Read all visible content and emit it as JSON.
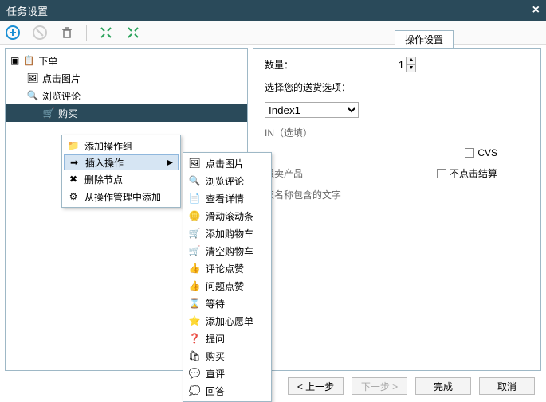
{
  "window": {
    "title": "任务设置",
    "close": "×"
  },
  "toolbar_icons": [
    "add",
    "stop",
    "trash",
    "expand",
    "collapse"
  ],
  "tree": {
    "root": "下单",
    "children": [
      {
        "label": "点击图片"
      },
      {
        "label": "浏览评论"
      },
      {
        "label": "购买",
        "selected": true
      }
    ]
  },
  "context_menu_1": {
    "items": [
      {
        "icon": "group",
        "label": "添加操作组"
      },
      {
        "icon": "insert",
        "label": "插入操作",
        "has_submenu": true,
        "highlighted": true
      },
      {
        "icon": "delete",
        "label": "删除节点"
      },
      {
        "icon": "fromlib",
        "label": "从操作管理中添加"
      }
    ]
  },
  "context_menu_2": {
    "items": [
      {
        "icon": "image",
        "label": "点击图片"
      },
      {
        "icon": "browse",
        "label": "浏览评论"
      },
      {
        "icon": "detail",
        "label": "查看详情"
      },
      {
        "icon": "scroll",
        "label": "滑动滚动条"
      },
      {
        "icon": "cart_add",
        "label": "添加购物车"
      },
      {
        "icon": "cart_clear",
        "label": "清空购物车"
      },
      {
        "icon": "thumb",
        "label": "评论点赞"
      },
      {
        "icon": "question",
        "label": "问题点赞"
      },
      {
        "icon": "wait",
        "label": "等待"
      },
      {
        "icon": "wish",
        "label": "添加心愿单"
      },
      {
        "icon": "ask",
        "label": "提问"
      },
      {
        "icon": "buy",
        "label": "购买"
      },
      {
        "icon": "live",
        "label": "直评"
      },
      {
        "icon": "answer",
        "label": "回答"
      }
    ]
  },
  "settings": {
    "tab": "操作设置",
    "qty_label": "数量：",
    "qty_value": "1",
    "shipping_label": "选择您的送货选项：",
    "shipping_value": "Index1",
    "asin_partial": "IN（选填）",
    "cvs_label": "CVS",
    "limited_partial": "限卖产品",
    "noclick_label": "不点击结算",
    "seller_partial": "家名称包含的文字"
  },
  "footer": {
    "prev": "< 上一步",
    "next": "下一步 >",
    "finish": "完成",
    "cancel": "取消"
  }
}
